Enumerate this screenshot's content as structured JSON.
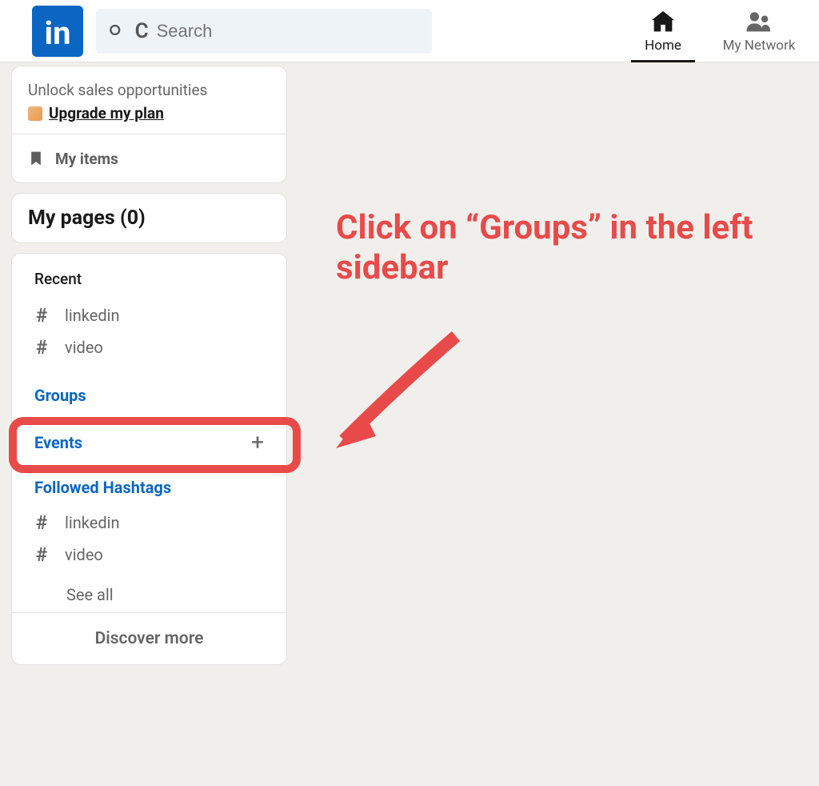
{
  "header": {
    "logo_text": "in",
    "search": {
      "placeholder": "Search"
    },
    "nav": {
      "home": "Home",
      "network": "My Network"
    }
  },
  "sidebar": {
    "promo": {
      "text": "Unlock sales opportunities",
      "link_label": "Upgrade my plan"
    },
    "my_items": "My items",
    "my_pages": "My pages (0)",
    "recent": {
      "label": "Recent",
      "items": [
        {
          "tag": "linkedin"
        },
        {
          "tag": "video"
        }
      ]
    },
    "groups": "Groups",
    "events": "Events",
    "followed": {
      "label": "Followed Hashtags",
      "items": [
        {
          "tag": "linkedin"
        },
        {
          "tag": "video"
        }
      ],
      "see_all": "See all"
    },
    "discover": "Discover more"
  },
  "annotation": {
    "text": "Click on “Groups” in the left sidebar"
  }
}
